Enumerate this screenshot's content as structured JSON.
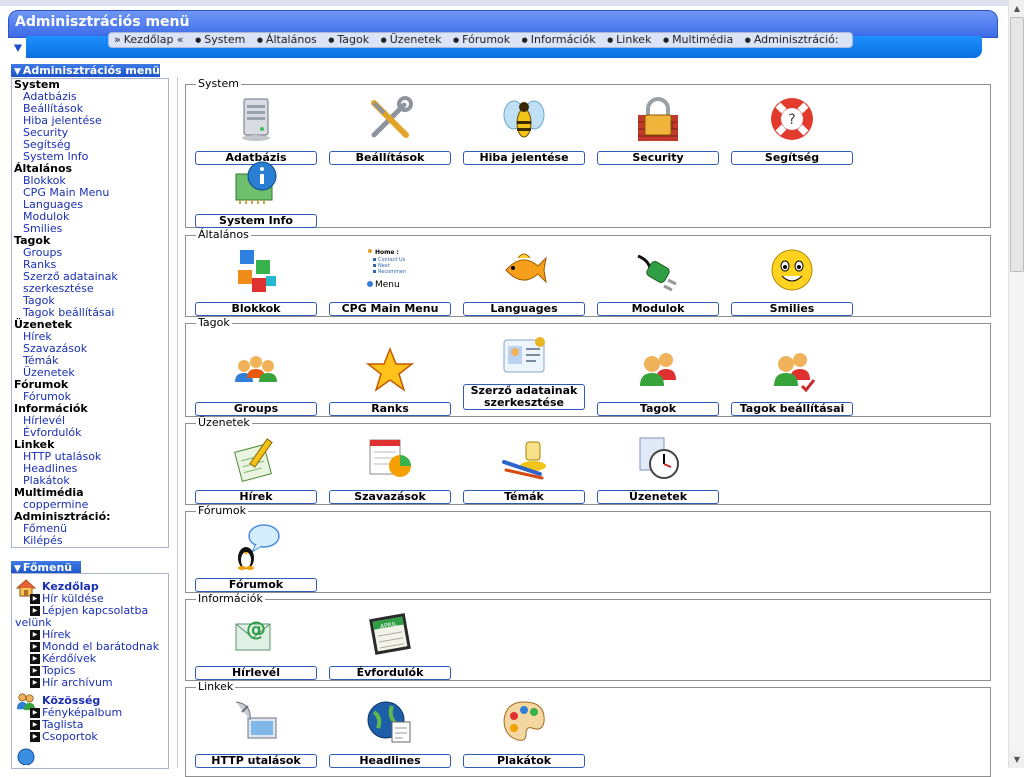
{
  "header": {
    "title": "Adminisztrációs menü",
    "nav": [
      "Kezdőlap",
      "System",
      "Általános",
      "Tagok",
      "Üzenetek",
      "Fórumok",
      "Információk",
      "Linkek",
      "Multimédia",
      "Adminisztráció:"
    ]
  },
  "sidebar": {
    "admin_title": "Adminisztrációs menü",
    "admin_groups": [
      {
        "title": "System",
        "links": [
          "Adatbázis",
          "Beállítások",
          "Hiba jelentése",
          "Security",
          "Segítség",
          "System Info"
        ]
      },
      {
        "title": "Általános",
        "links": [
          "Blokkok",
          "CPG Main Menu",
          "Languages",
          "Modulok",
          "Smilies"
        ]
      },
      {
        "title": "Tagok",
        "links": [
          "Groups",
          "Ranks",
          "Szerző adatainak",
          "szerkesztése",
          "Tagok",
          "Tagok beállításai"
        ]
      },
      {
        "title": "Üzenetek",
        "links": [
          "Hírek",
          "Szavazások",
          "Témák",
          "Üzenetek"
        ]
      },
      {
        "title": "Fórumok",
        "links": [
          "Fórumok"
        ]
      },
      {
        "title": "Információk",
        "links": [
          "Hírlevél",
          "Évfordulók"
        ]
      },
      {
        "title": "Linkek",
        "links": [
          "HTTP utalások",
          "Headlines",
          "Plakátok"
        ]
      },
      {
        "title": "Multimédia",
        "links": [
          "coppermine"
        ]
      },
      {
        "title": "Adminisztráció:",
        "links": [
          "Főmenü",
          "Kilépés"
        ]
      }
    ],
    "main_title": "Főmenü",
    "kezdolap": {
      "title": "Kezdőlap",
      "links": [
        "Hír küldése",
        "Lépjen kapcsolatba",
        "velünk",
        "Hírek",
        "Mondd el barátodnak",
        "Kérdőívek",
        "Topics",
        "Hír archívum"
      ]
    },
    "kozosseg": {
      "title": "Közösség",
      "links": [
        "Fényképalbum",
        "Taglista",
        "Csoportok"
      ]
    }
  },
  "panels": {
    "system": {
      "legend": "System",
      "items": [
        "Adatbázis",
        "Beállítások",
        "Hiba jelentése",
        "Security",
        "Segítség",
        "System Info"
      ]
    },
    "altalanos": {
      "legend": "Általános",
      "items": [
        "Blokkok",
        "CPG Main Menu",
        "Languages",
        "Modulok",
        "Smilies"
      ]
    },
    "tagok": {
      "legend": "Tagok",
      "items": [
        "Groups",
        "Ranks",
        "Szerző adatainak szerkesztése",
        "Tagok",
        "Tagok beállításai"
      ]
    },
    "uzenetek": {
      "legend": "Üzenetek",
      "items": [
        "Hírek",
        "Szavazások",
        "Témák",
        "Üzenetek"
      ]
    },
    "forumok": {
      "legend": "Fórumok",
      "items": [
        "Fórumok"
      ]
    },
    "informaciok": {
      "legend": "Információk",
      "items": [
        "Hírlevél",
        "Évfordulók"
      ]
    },
    "linkek": {
      "legend": "Linkek",
      "items": [
        "HTTP utalások",
        "Headlines",
        "Plakátok"
      ]
    }
  },
  "cpg_menu_preview": {
    "heading": "Home :",
    "lines": [
      "Contact Us",
      "Next",
      "Recommen"
    ],
    "label": "Menu"
  },
  "calendar_label": "APRIL",
  "colors": {
    "title_bar": "#4a76ee",
    "nav_bar": "#1e90ff",
    "link": "#1a2fb4",
    "button_border": "#2f5bb7"
  }
}
